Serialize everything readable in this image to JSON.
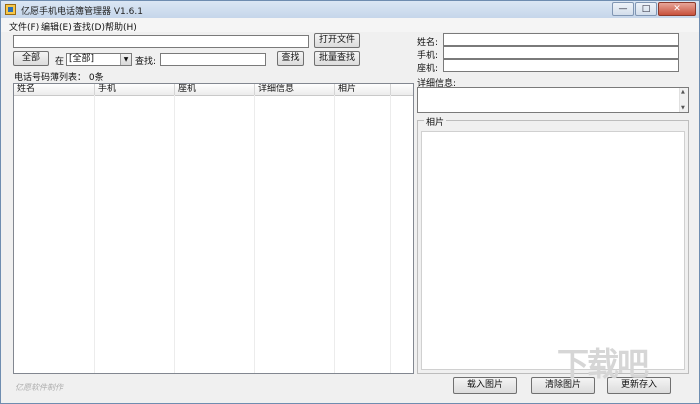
{
  "window": {
    "title": "亿愿手机电话簿管理器 V1.6.1"
  },
  "menu": [
    {
      "label": "文件(F)"
    },
    {
      "label": "编辑(E)"
    },
    {
      "label": "查找(D)"
    },
    {
      "label": "帮助(H)"
    }
  ],
  "toolbar": {
    "open_file_label": "打开文件",
    "all_label": "全部",
    "in_label": "在",
    "scope_selected": "[全部]",
    "find_label": "查找:",
    "find_value": "",
    "search_label": "查找",
    "batch_search_label": "批量查找"
  },
  "list": {
    "summary": "电话号码薄列表：  0条",
    "columns": [
      "姓名",
      "手机",
      "座机",
      "详细信息",
      "相片"
    ]
  },
  "detail": {
    "name_label": "姓名:",
    "mobile_label": "手机:",
    "landline_label": "座机:",
    "details_label": "详细信息:",
    "photo_group_label": "相片",
    "name_value": "",
    "mobile_value": "",
    "landline_value": "",
    "details_value": ""
  },
  "footer": {
    "credit": "亿愿软件制作",
    "load_photo_label": "载入图片",
    "clear_photo_label": "清除图片",
    "update_label": "更新存入"
  },
  "watermark": {
    "logo_text": "下载吧"
  }
}
